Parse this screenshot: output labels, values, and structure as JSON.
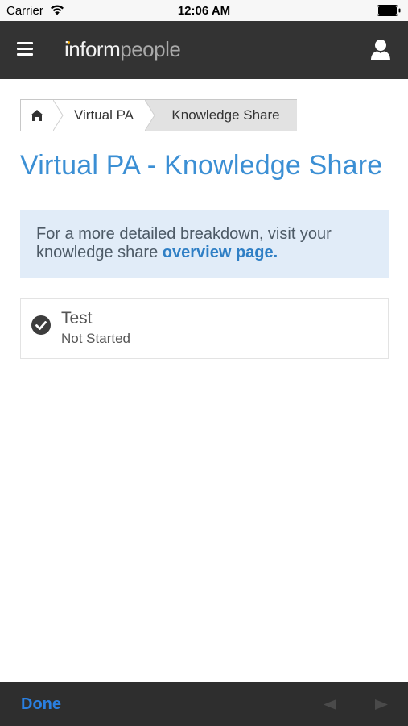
{
  "status_bar": {
    "carrier": "Carrier",
    "time": "12:06 AM"
  },
  "header": {
    "logo_part1": "inform",
    "logo_part2": "people"
  },
  "breadcrumb": {
    "home_icon": "home-icon",
    "items": [
      {
        "label": "Virtual PA"
      }
    ],
    "current": "Knowledge Share"
  },
  "page_title": "Virtual PA - Knowledge Share",
  "info": {
    "text": "For a more detailed breakdown, visit your knowledge share ",
    "link_text": "overview page."
  },
  "items": [
    {
      "title": "Test",
      "status": "Not Started",
      "icon": "check-circle-icon"
    }
  ],
  "toolbar": {
    "done_label": "Done"
  },
  "colors": {
    "accent": "#3b8fd4",
    "header_bg": "#333333",
    "info_bg": "#e1ecf8",
    "done": "#2a7fe0"
  }
}
